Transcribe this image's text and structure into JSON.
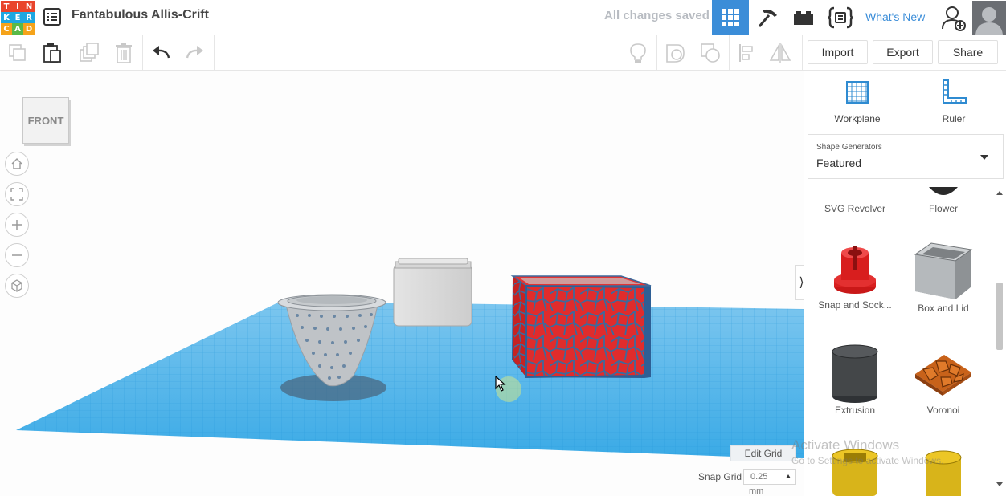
{
  "logo": {
    "letters": [
      "T",
      "I",
      "N",
      "K",
      "E",
      "R",
      "C",
      "A",
      "D"
    ],
    "colors": [
      "#e9452c",
      "#e9452c",
      "#e9452c",
      "#1ea7e1",
      "#1ea7e1",
      "#1ea7e1",
      "#f5a31a",
      "#59b947",
      "#f5a31a"
    ]
  },
  "header": {
    "design_title": "Fantabulous Allis-Crift",
    "save_status": "All changes saved",
    "whats_new": "What's New",
    "accent_color": "#3b8dd8"
  },
  "toolbar": {
    "import_label": "Import",
    "export_label": "Export",
    "share_label": "Share"
  },
  "viewport": {
    "viewcube_label": "FRONT",
    "edit_grid_label": "Edit Grid",
    "snap_grid_label": "Snap Grid",
    "snap_grid_value": "0.25",
    "snap_grid_unit": "mm"
  },
  "panel": {
    "workplane_label": "Workplane",
    "ruler_label": "Ruler",
    "shape_generators_label": "Shape Generators",
    "shape_generators_value": "Featured",
    "shapes": [
      {
        "name": "SVG Revolver"
      },
      {
        "name": "Flower"
      },
      {
        "name": "Snap and Sock..."
      },
      {
        "name": "Box and Lid"
      },
      {
        "name": "Extrusion"
      },
      {
        "name": "Voronoi"
      }
    ]
  },
  "watermark": {
    "line1": "Activate Windows",
    "line2": "Go to Settings to activate Windows."
  }
}
